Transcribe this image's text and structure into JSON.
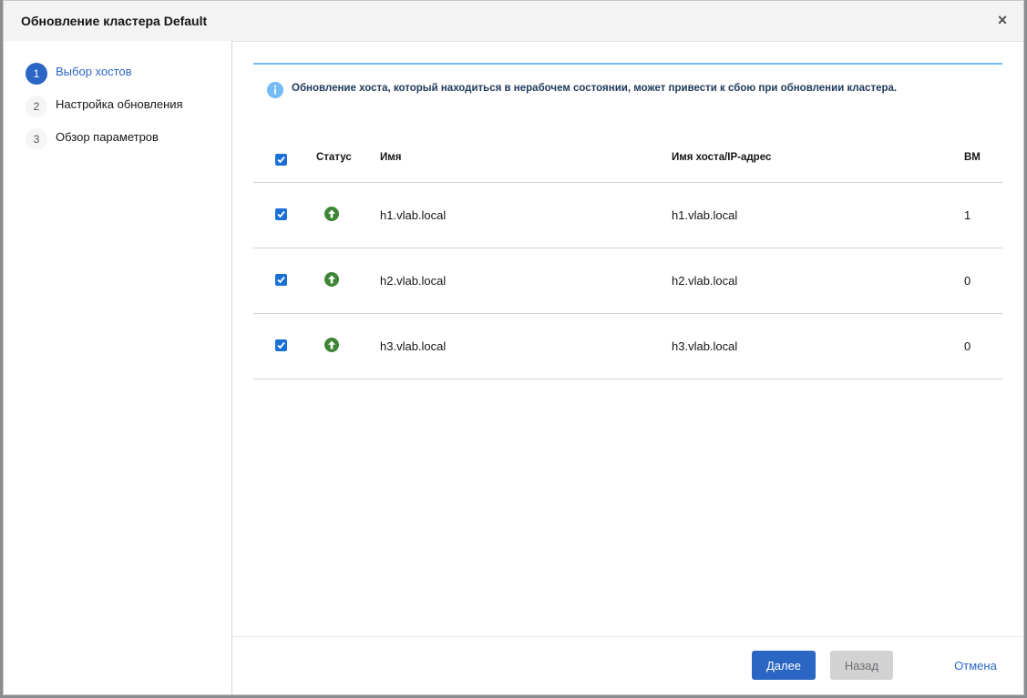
{
  "dialog": {
    "title": "Обновление кластера Default",
    "close_icon": "close-icon"
  },
  "steps": [
    {
      "number": "1",
      "label": "Выбор хостов",
      "active": true
    },
    {
      "number": "2",
      "label": "Настройка обновления",
      "active": false
    },
    {
      "number": "3",
      "label": "Обзор параметров",
      "active": false
    }
  ],
  "alert": {
    "icon": "info-icon",
    "message": "Обновление хоста, который находиться в нерабочем состоянии, может привести к сбою при обновлении кластера."
  },
  "table": {
    "header_checked": true,
    "columns": {
      "status": "Статус",
      "name": "Имя",
      "host": "Имя хоста/IP-адрес",
      "vm": "ВМ"
    },
    "rows": [
      {
        "checked": true,
        "status": "up-arrow-icon",
        "name": "h1.vlab.local",
        "host": "h1.vlab.local",
        "vm": "1"
      },
      {
        "checked": true,
        "status": "up-arrow-icon",
        "name": "h2.vlab.local",
        "host": "h2.vlab.local",
        "vm": "0"
      },
      {
        "checked": true,
        "status": "up-arrow-icon",
        "name": "h3.vlab.local",
        "host": "h3.vlab.local",
        "vm": "0"
      }
    ]
  },
  "footer": {
    "next_label": "Далее",
    "back_label": "Назад",
    "cancel_label": "Отмена"
  },
  "colors": {
    "accent": "#2b66c5",
    "status_up": "#3e8635",
    "alert_border": "#73bcf7"
  }
}
